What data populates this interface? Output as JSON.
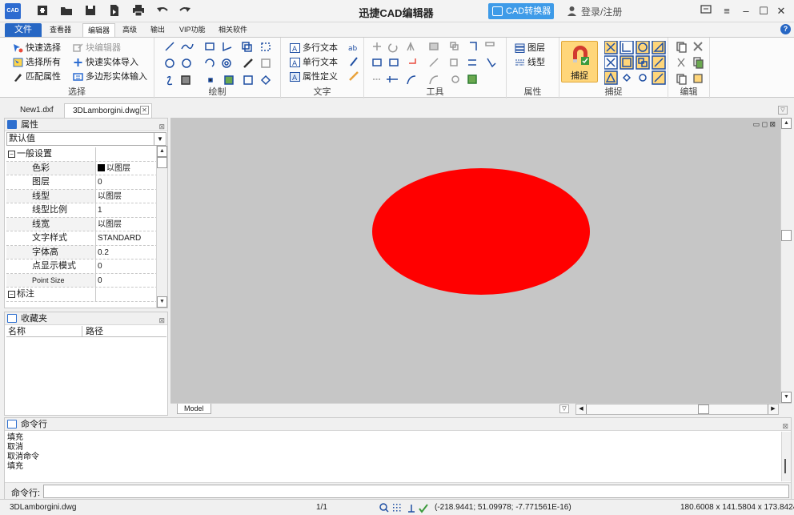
{
  "titlebar": {
    "logo_text": "CAD",
    "title": "迅捷CAD编辑器",
    "converter_label": "CAD转换器",
    "login_label": "登录/注册"
  },
  "tabs": [
    "文件",
    "查看器",
    "编辑器",
    "高级",
    "输出",
    "VIP功能",
    "相关软件"
  ],
  "active_tab": "编辑器",
  "ribbon": {
    "select_group": {
      "label": "选择",
      "quick_select": "快速选择",
      "block_editor": "块编辑器",
      "select_all": "选择所有",
      "quick_entity_import": "快速实体导入",
      "match_properties": "匹配属性",
      "polygon_entity_input": "多边形实体输入"
    },
    "draw_group": {
      "label": "绘制"
    },
    "text_group": {
      "label": "文字",
      "multiline_text": "多行文本",
      "single_line_text": "单行文本",
      "attribute_define": "属性定义"
    },
    "tools_group": {
      "label": "工具"
    },
    "props_group": {
      "label": "属性",
      "layer": "图层",
      "linetype": "线型"
    },
    "snap_group": {
      "label": "捕捉",
      "snap_button": "捕捉"
    },
    "edit_group": {
      "label": "编辑"
    }
  },
  "doc_tabs": [
    "New1.dxf",
    "3DLamborgini.dwg"
  ],
  "properties_panel": {
    "title": "属性",
    "dropdown_value": "默认值",
    "general_group": "一般设置",
    "rows": [
      {
        "key": "色彩",
        "value": "以图层"
      },
      {
        "key": "图层",
        "value": "0"
      },
      {
        "key": "线型",
        "value": "以图层"
      },
      {
        "key": "线型比例",
        "value": "1"
      },
      {
        "key": "线宽",
        "value": "以图层"
      },
      {
        "key": "文字样式",
        "value": "STANDARD"
      },
      {
        "key": "字体高",
        "value": "0.2"
      },
      {
        "key": "点显示模式",
        "value": "0"
      },
      {
        "key": "Point Size",
        "value": "0"
      }
    ],
    "annotation_group": "标注"
  },
  "favorites_panel": {
    "title": "收藏夹",
    "col_name": "名称",
    "col_path": "路径"
  },
  "canvas": {
    "background_color": "#c6c6c6",
    "shape_fill": "#ff0000",
    "model_tab": "Model"
  },
  "command_panel": {
    "title": "命令行",
    "log": [
      "填充",
      "取消",
      "取消命令",
      "填充"
    ],
    "input_label": "命令行:"
  },
  "statusbar": {
    "file": "3DLamborgini.dwg",
    "page": "1/1",
    "coords": "(-218.9441; 51.09978; -7.771561E-16)",
    "dims": "180.6008 x 141.5804 x 173.8424"
  }
}
